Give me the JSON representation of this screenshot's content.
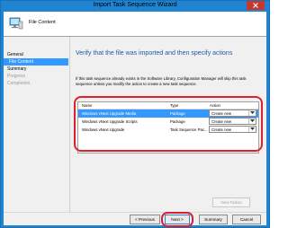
{
  "window": {
    "title": "Import Task Sequence Wizard",
    "close_glyph": "✕"
  },
  "header": {
    "page_title": "File Content",
    "icon": "computer-icon"
  },
  "nav": {
    "items": [
      {
        "label": "General",
        "state": "done"
      },
      {
        "label": "File Content",
        "state": "current"
      },
      {
        "label": "Summary",
        "state": "normal"
      },
      {
        "label": "Progress",
        "state": "disabled"
      },
      {
        "label": "Completion",
        "state": "disabled"
      }
    ]
  },
  "main": {
    "heading": "Verify that the file was imported and then specify actions",
    "description": "If this task sequence already exists in the Software Library, Configuration Manager will skip this task sequence unless you modify the action to create a new task sequence.",
    "table": {
      "columns": [
        "Name",
        "Type",
        "Action"
      ],
      "rows": [
        {
          "name": "Windows vNext Upgrade Media",
          "type": "Package",
          "action": "Create new",
          "selected": true
        },
        {
          "name": "Windows vNext Upgrade Scripts",
          "type": "Package",
          "action": "Create new",
          "selected": false
        },
        {
          "name": "Windows vNext Upgrade",
          "type": "Task Sequence Pac...",
          "action": "Create new",
          "selected": false
        }
      ]
    },
    "view_failure_label": "View Failure"
  },
  "footer": {
    "previous": "< Previous",
    "next": "Next >",
    "summary": "Summary",
    "cancel": "Cancel"
  },
  "colors": {
    "accent": "#1f84d2",
    "selection": "#3399ff",
    "highlight": "#d9222a",
    "heading": "#1f5aa8"
  }
}
